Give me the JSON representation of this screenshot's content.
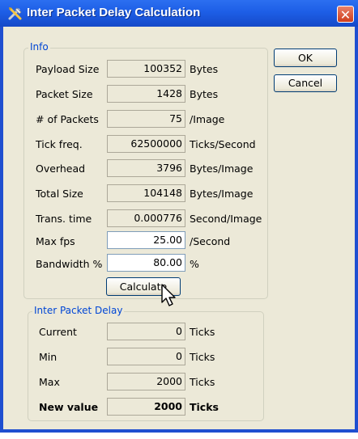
{
  "window": {
    "title": "Inter Packet Delay Calculation",
    "close_glyph": "✕"
  },
  "buttons": {
    "ok": "OK",
    "cancel": "Cancel",
    "calculate": "Calculate"
  },
  "info": {
    "label": "Info",
    "rows": [
      {
        "label": "Payload Size",
        "value": "100352",
        "unit": "Bytes"
      },
      {
        "label": "Packet Size",
        "value": "1428",
        "unit": "Bytes"
      },
      {
        "label": "# of Packets",
        "value": "75",
        "unit": "/Image"
      },
      {
        "label": "Tick freq.",
        "value": "62500000",
        "unit": "Ticks/Second"
      },
      {
        "label": "Overhead",
        "value": "3796",
        "unit": "Bytes/Image"
      },
      {
        "label": "Total Size",
        "value": "104148",
        "unit": "Bytes/Image"
      },
      {
        "label": "Trans. time",
        "value": "0.000776",
        "unit": "Second/Image"
      },
      {
        "label": "Max fps",
        "value": "25.00",
        "unit": "/Second"
      },
      {
        "label": "Bandwidth %",
        "value": "80.00",
        "unit": "%"
      }
    ]
  },
  "delay": {
    "label": "Inter Packet Delay",
    "rows": [
      {
        "label": "Current",
        "value": "0",
        "unit": "Ticks"
      },
      {
        "label": "Min",
        "value": "0",
        "unit": "Ticks"
      },
      {
        "label": "Max",
        "value": "2000",
        "unit": "Ticks"
      },
      {
        "label": "New value",
        "value": "2000",
        "unit": "Ticks"
      }
    ]
  },
  "icons": {
    "title": "tools-icon",
    "cursor": "arrow-cursor-icon"
  }
}
